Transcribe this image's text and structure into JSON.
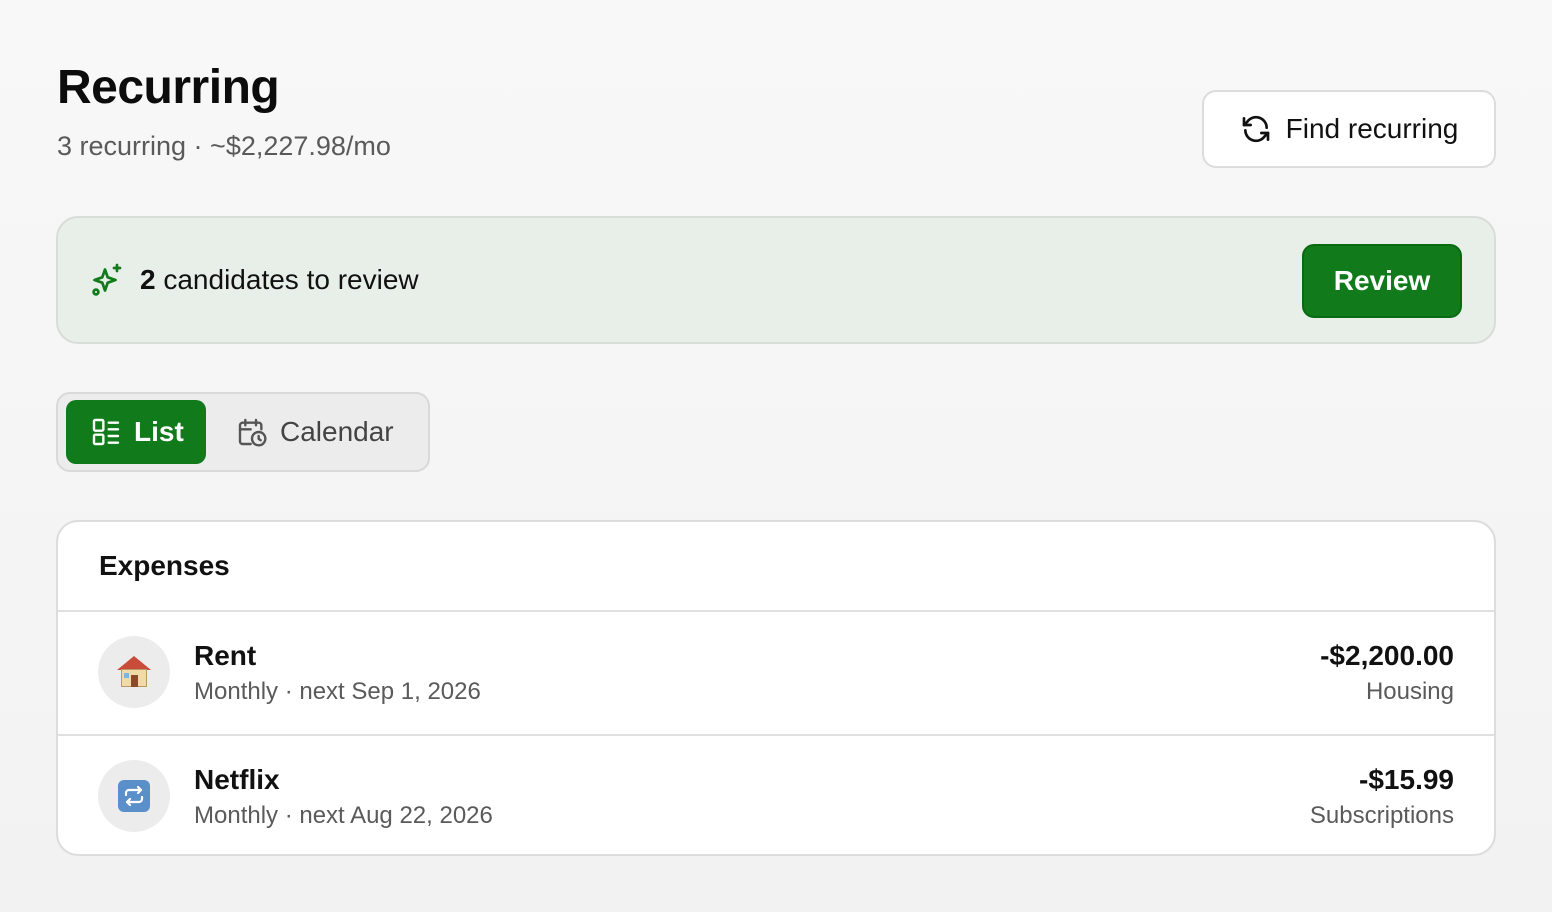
{
  "header": {
    "title": "Recurring",
    "subtitle": "3 recurring · ~$2,227.98/mo",
    "find_button_label": "Find recurring"
  },
  "banner": {
    "count": "2",
    "text": " candidates to review",
    "review_label": "Review"
  },
  "view_toggle": {
    "list_label": "List",
    "calendar_label": "Calendar",
    "selected": "List"
  },
  "expenses": {
    "heading": "Expenses",
    "items": [
      {
        "name": "Rent",
        "meta": "Monthly · next Sep 1, 2026",
        "amount": "-$2,200.00",
        "category": "Housing",
        "icon": "house-icon"
      },
      {
        "name": "Netflix",
        "meta": "Monthly · next Aug 22, 2026",
        "amount": "-$15.99",
        "category": "Subscriptions",
        "icon": "repeat-icon"
      }
    ]
  },
  "colors": {
    "accent": "#117a1a",
    "banner_bg": "#e8efe8"
  }
}
